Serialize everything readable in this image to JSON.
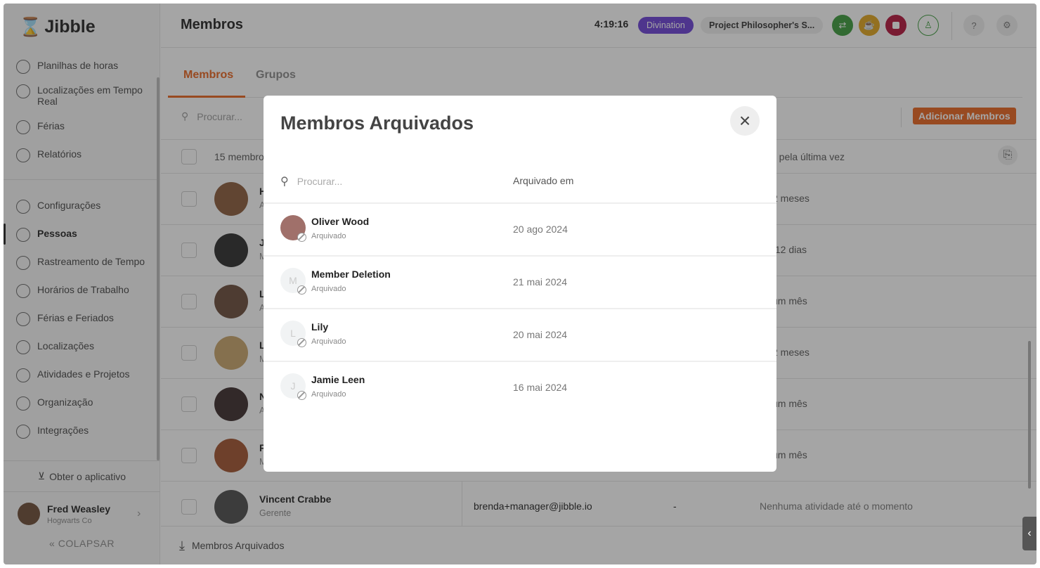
{
  "app": {
    "logo": "Jibble"
  },
  "sidebar": {
    "items": [
      {
        "label": "Planilhas de horas",
        "icon": "clock-icon"
      },
      {
        "label": "Localizações em Tempo Real",
        "icon": "location-pin-icon"
      },
      {
        "label": "Férias",
        "icon": "suitcase-icon"
      },
      {
        "label": "Relatórios",
        "icon": "clipboard-icon"
      },
      {
        "label": "Configurações",
        "icon": "chevron-up-icon"
      },
      {
        "label": "Pessoas",
        "icon": "people-icon"
      },
      {
        "label": "Rastreamento de Tempo",
        "icon": "time-tracking-icon"
      },
      {
        "label": "Horários de Trabalho",
        "icon": "schedule-icon"
      },
      {
        "label": "Férias e Feriados",
        "icon": "suitcase-icon"
      },
      {
        "label": "Localizações",
        "icon": "location-pin-icon"
      },
      {
        "label": "Atividades e Projetos",
        "icon": "tag-icon"
      },
      {
        "label": "Organização",
        "icon": "gear-icon"
      },
      {
        "label": "Integrações",
        "icon": "plug-icon"
      }
    ],
    "get_app": "Obter o aplicativo",
    "user": {
      "name": "Fred Weasley",
      "org": "Hogwarts Co"
    },
    "collapse": "COLAPSAR"
  },
  "header": {
    "title": "Membros",
    "timer": "4:19:16",
    "activity": "Divination",
    "project": "Project Philosopher's S...",
    "colors": {
      "activity": "#6a3fd6",
      "clock_in": "#3a9a3a",
      "break": "#e0a41c",
      "stop": "#b3123a",
      "accent": "#e8621c"
    }
  },
  "tabs": [
    {
      "label": "Membros"
    },
    {
      "label": "Grupos"
    }
  ],
  "toolbar": {
    "search_placeholder": "Procurar...",
    "add_label": "Adicionar Membros"
  },
  "table": {
    "count_label": "15 membros",
    "last_active_header": "o pela última vez",
    "rows": [
      {
        "name": "H",
        "sub": "A",
        "last": "2 meses",
        "color": "#8a5a3a"
      },
      {
        "name": "J",
        "sub": "M",
        "last": ".12 dias",
        "color": "#2a2a2a"
      },
      {
        "name": "L",
        "sub": "A",
        "last": "um mês",
        "color": "#6a4a3a"
      },
      {
        "name": "L",
        "sub": "M",
        "last": "2 meses",
        "color": "#c9a46a"
      },
      {
        "name": "N",
        "sub": "A",
        "last": "um mês",
        "color": "#3a2a2a"
      },
      {
        "name": "F",
        "sub": "M",
        "last": "um mês",
        "color": "#a0522d"
      },
      {
        "name": "Vincent Crabbe",
        "sub": "Gerente",
        "email": "brenda+manager@jibble.io",
        "dash": "-",
        "last": "Nenhuma atividade até o momento",
        "color": "#4a4a4a"
      }
    ]
  },
  "footer": {
    "archived_label": "Membros Arquivados"
  },
  "modal": {
    "title": "Membros Arquivados",
    "search_placeholder": "Procurar...",
    "column": "Arquivado em",
    "rows": [
      {
        "name": "Oliver Wood",
        "initial": "",
        "status": "Arquivado",
        "date": "20 ago 2024"
      },
      {
        "name": "Member Deletion",
        "initial": "M",
        "status": "Arquivado",
        "date": "21 mai 2024"
      },
      {
        "name": "Lily",
        "initial": "L",
        "status": "Arquivado",
        "date": "20 mai 2024"
      },
      {
        "name": "Jamie Leen",
        "initial": "J",
        "status": "Arquivado",
        "date": "16 mai 2024"
      }
    ]
  }
}
